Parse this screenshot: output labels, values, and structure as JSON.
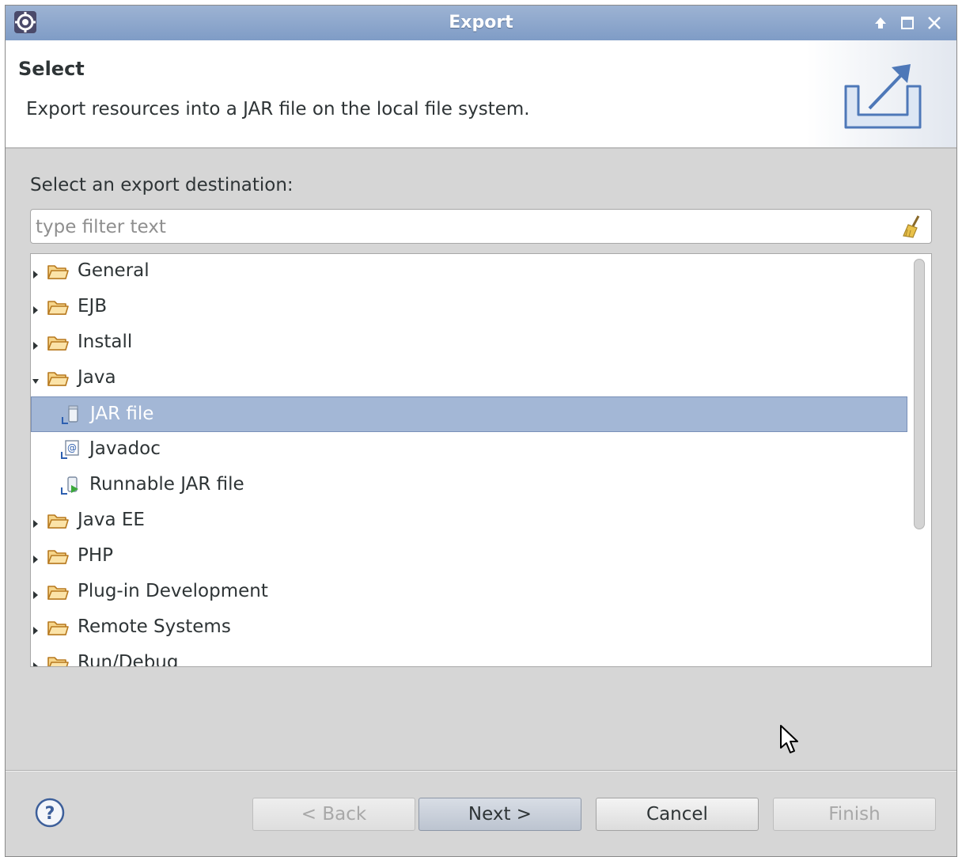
{
  "window": {
    "title": "Export"
  },
  "banner": {
    "title": "Select",
    "description": "Export resources into a JAR file on the local file system."
  },
  "body": {
    "destination_label": "Select an export destination:",
    "filter_placeholder": "type filter text",
    "filter_value": ""
  },
  "tree": {
    "items": [
      {
        "label": "General",
        "kind": "folder",
        "expanded": false
      },
      {
        "label": "EJB",
        "kind": "folder",
        "expanded": false
      },
      {
        "label": "Install",
        "kind": "folder",
        "expanded": false
      },
      {
        "label": "Java",
        "kind": "folder",
        "expanded": true
      },
      {
        "label": "JAR file",
        "kind": "jar",
        "selected": true
      },
      {
        "label": "Javadoc",
        "kind": "javadoc"
      },
      {
        "label": "Runnable JAR file",
        "kind": "runnable-jar"
      },
      {
        "label": "Java EE",
        "kind": "folder",
        "expanded": false
      },
      {
        "label": "PHP",
        "kind": "folder",
        "expanded": false
      },
      {
        "label": "Plug-in Development",
        "kind": "folder",
        "expanded": false
      },
      {
        "label": "Remote Systems",
        "kind": "folder",
        "expanded": false
      },
      {
        "label": "Run/Debug",
        "kind": "folder",
        "expanded": false
      }
    ]
  },
  "buttons": {
    "back": "< Back",
    "next": "Next >",
    "cancel": "Cancel",
    "finish": "Finish"
  },
  "colors": {
    "titlebar": "#8aa5cc",
    "selection": "#a3b7d6",
    "folder": "#e8a33c"
  }
}
